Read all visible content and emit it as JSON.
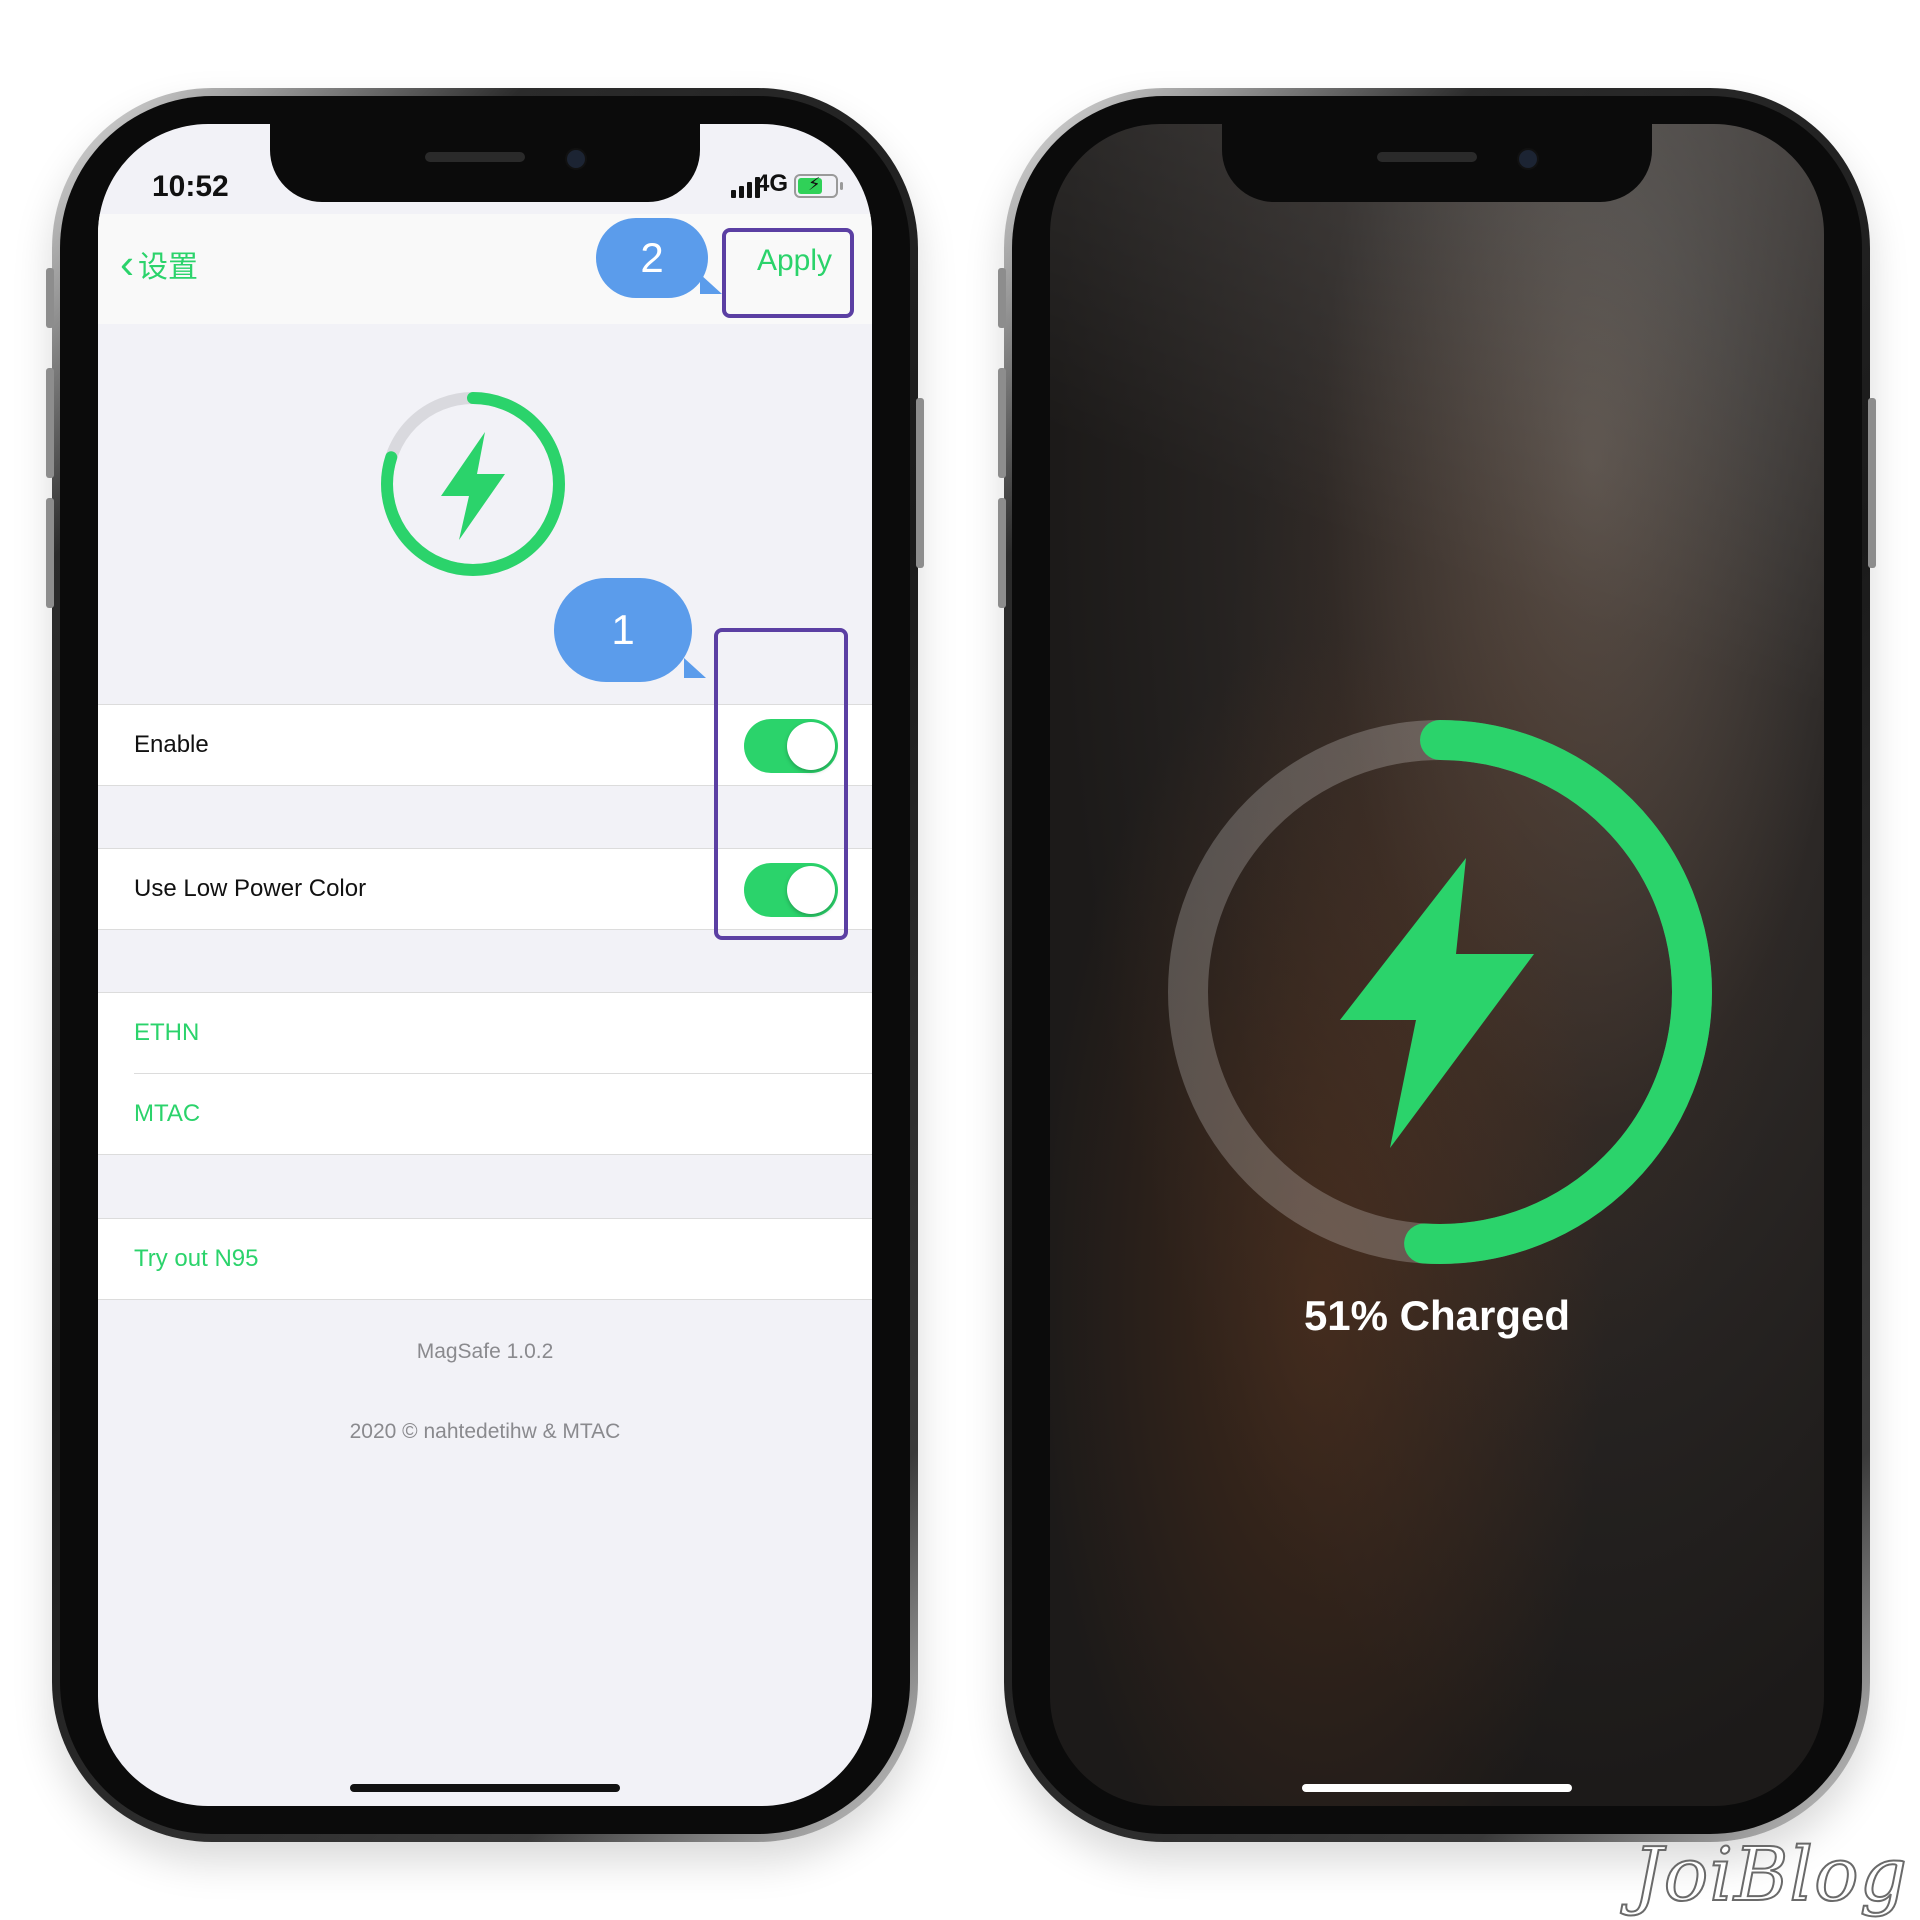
{
  "left_phone": {
    "status": {
      "time": "10:52",
      "network": "4G"
    },
    "nav": {
      "back_label": "设置",
      "apply_label": "Apply"
    },
    "settings": {
      "enable_label": "Enable",
      "enable_on": true,
      "low_power_label": "Use Low Power Color",
      "low_power_on": true,
      "links": [
        "ETHN",
        "MTAC"
      ],
      "try_label": "Try out N95"
    },
    "footer": {
      "version": "MagSafe 1.0.2",
      "copyright": "2020 © nahtedetihw & MTAC"
    },
    "annotations": {
      "step1": "1",
      "step2": "2"
    }
  },
  "right_phone": {
    "charge_text": "51% Charged",
    "charge_fraction": 0.51
  },
  "watermark": "JoiBlog",
  "colors": {
    "accent_green": "#2bd36b",
    "annotation_purple": "#5b3fa3",
    "bubble_blue": "#5b9ceb"
  }
}
